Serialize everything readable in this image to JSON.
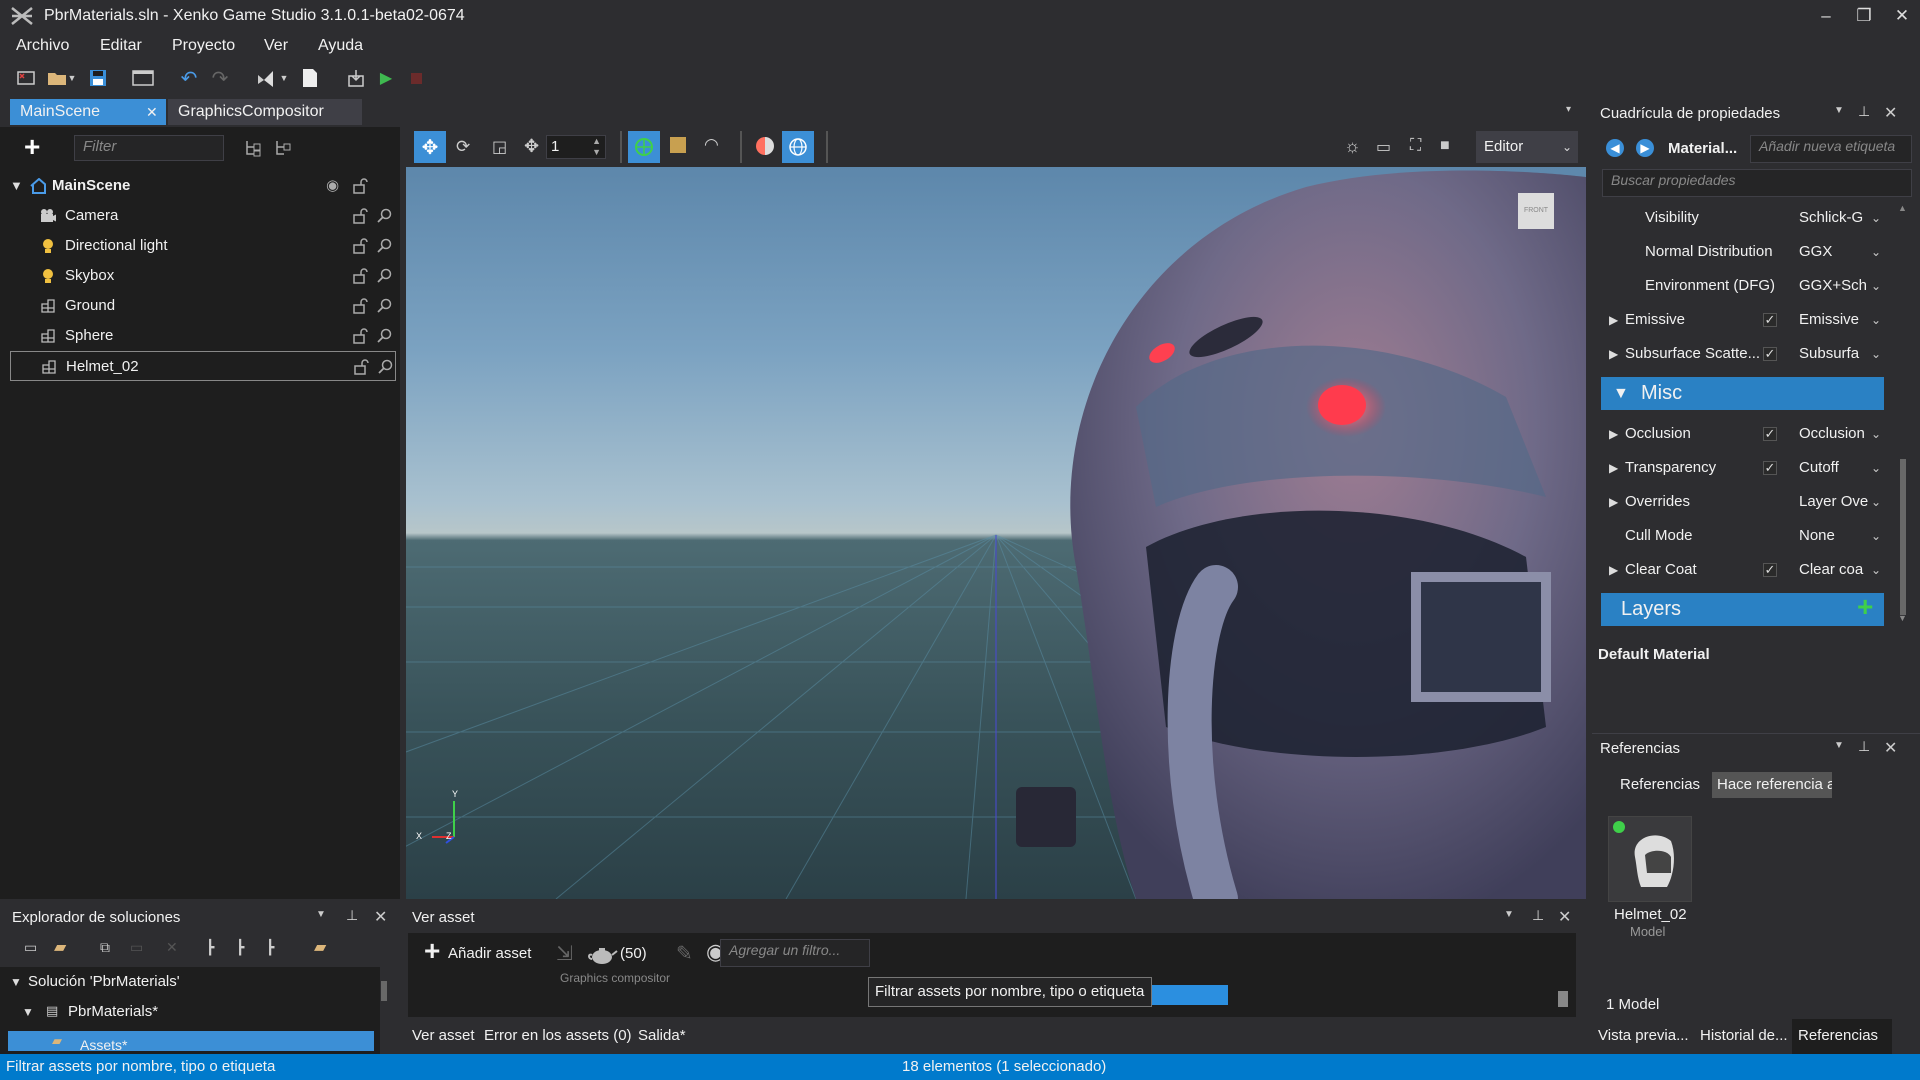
{
  "window": {
    "title": "PbrMaterials.sln - Xenko Game Studio 3.1.0.1-beta02-0674"
  },
  "menu": [
    "Archivo",
    "Editar",
    "Proyecto",
    "Ver",
    "Ayuda"
  ],
  "tabs": [
    {
      "label": "MainScene",
      "active": true
    },
    {
      "label": "GraphicsCompositor",
      "active": false
    }
  ],
  "scene_tree": {
    "filter_placeholder": "Filter",
    "root": "MainScene",
    "items": [
      "Camera",
      "Directional light",
      "Skybox",
      "Ground",
      "Sphere",
      "Helmet_02"
    ],
    "selected": "Helmet_02"
  },
  "viewport": {
    "snap_value": "1",
    "mode": "Editor",
    "gizmo_cube_label": "FRONT",
    "axis": {
      "x": "X",
      "y": "Y",
      "z": "Z"
    }
  },
  "properties": {
    "panel_title": "Cuadrícula de propiedades",
    "object_name": "Material...",
    "tag_placeholder": "Añadir nueva etiqueta",
    "search_placeholder": "Buscar propiedades",
    "rows_top": [
      {
        "name": "Visibility",
        "value": "Schlick-G",
        "expandable": false,
        "checkbox": false
      },
      {
        "name": "Normal Distribution",
        "value": "GGX",
        "expandable": false,
        "checkbox": false
      },
      {
        "name": "Environment (DFG)",
        "value": "GGX+Sch",
        "expandable": false,
        "checkbox": false
      },
      {
        "name": "Emissive",
        "value": "Emissive",
        "expandable": true,
        "checkbox": true
      },
      {
        "name": "Subsurface Scatte...",
        "value": "Subsurfa",
        "expandable": true,
        "checkbox": true
      }
    ],
    "section_misc": "Misc",
    "rows_misc": [
      {
        "name": "Occlusion",
        "value": "Occlusion",
        "expandable": true,
        "checkbox": true
      },
      {
        "name": "Transparency",
        "value": "Cutoff",
        "expandable": true,
        "checkbox": true
      },
      {
        "name": "Overrides",
        "value": "Layer Overrid",
        "expandable": true,
        "checkbox": false
      },
      {
        "name": "Cull Mode",
        "value": "None",
        "expandable": false,
        "checkbox": false
      },
      {
        "name": "Clear Coat",
        "value": "Clear coa",
        "expandable": true,
        "checkbox": true
      }
    ],
    "section_layers": "Layers",
    "footer": "Default Material"
  },
  "references": {
    "panel_title": "Referencias",
    "tab_refs": "Referencias",
    "tab_refby": "Hace referencia a",
    "asset_name": "Helmet_02",
    "asset_type": "Model",
    "count": "1 Model",
    "bottom_tabs": [
      "Vista previa...",
      "Historial de...",
      "Referencias"
    ]
  },
  "solution_explorer": {
    "panel_title": "Explorador de soluciones",
    "solution": "Solución 'PbrMaterials'",
    "project": "PbrMaterials*",
    "assets": "Assets*"
  },
  "asset_view": {
    "panel_title": "Ver asset",
    "add_label": "Añadir asset",
    "count": "(50)",
    "graphics_compositor": "Graphics compositor",
    "filter_placeholder": "Agregar un filtro...",
    "tooltip": "Filtrar assets por nombre, tipo o etiqueta",
    "bottom_tabs": [
      "Ver asset",
      "Error en los assets (0)",
      "Salida*"
    ]
  },
  "status_bar": {
    "left": "Filtrar assets por nombre, tipo o etiqueta",
    "center": "18 elementos (1 seleccionado)"
  },
  "colors": {
    "accent": "#007acc",
    "section": "#2a81c4",
    "tab_active": "#3c8fd6"
  }
}
